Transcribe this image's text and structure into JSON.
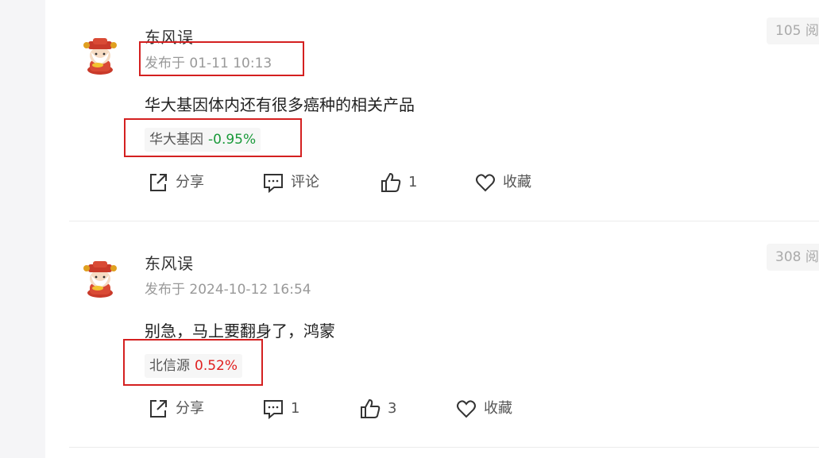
{
  "posts": [
    {
      "author": "东风误",
      "time": "发布于 01-11 10:13",
      "reads": "105 阅",
      "content": "华大基因体内还有很多癌种的相关产品",
      "stock": {
        "name": "华大基因",
        "change": "-0.95%",
        "color": "#1a9a3a"
      },
      "actions": {
        "share": "分享",
        "comment": "评论",
        "like": "1",
        "favorite": "收藏"
      }
    },
    {
      "author": "东风误",
      "time": "发布于 2024-10-12 16:54",
      "reads": "308 阅",
      "content": "别急，马上要翻身了，鸿蒙",
      "stock": {
        "name": "北信源",
        "change": "0.52%",
        "color": "#e02020"
      },
      "actions": {
        "share": "分享",
        "comment": "1",
        "like": "3",
        "favorite": "收藏"
      }
    }
  ],
  "colors": {
    "annotation_box": "#d42020",
    "rise": "#e02020",
    "fall": "#1a9a3a"
  }
}
